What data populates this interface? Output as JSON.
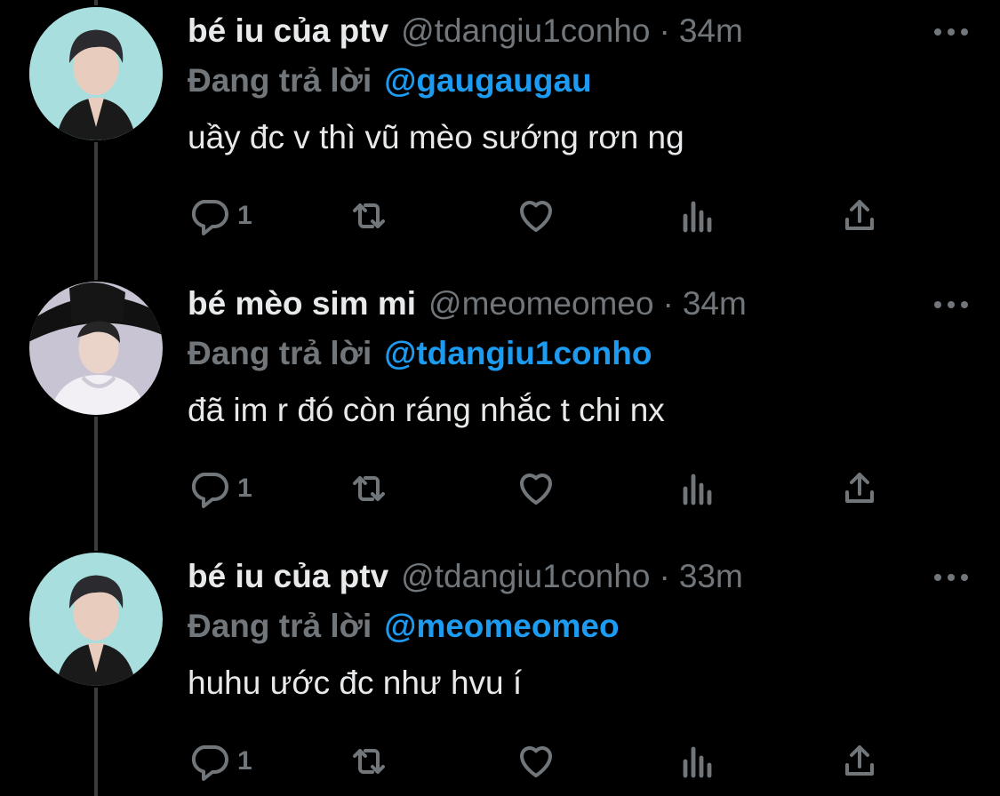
{
  "reply_prefix": "Đang trả lời",
  "tweets": [
    {
      "display_name": "bé iu của ptv",
      "handle": "@tdangiu1conho",
      "separator": "·",
      "time": "34m",
      "reply_to": "@gaugaugau",
      "text": "uầy đc v thì vũ mèo sướng rơn ng",
      "reply_count": "1"
    },
    {
      "display_name": "bé mèo sim mi",
      "handle": "@meomeomeo",
      "separator": "·",
      "time": "34m",
      "reply_to": "@tdangiu1conho",
      "text": "đã im r đó còn ráng nhắc t chi nx",
      "reply_count": "1"
    },
    {
      "display_name": "bé iu của ptv",
      "handle": "@tdangiu1conho",
      "separator": "·",
      "time": "33m",
      "reply_to": "@meomeomeo",
      "text": "huhu ước đc như hvu í",
      "reply_count": "1"
    }
  ],
  "colors": {
    "background": "#000000",
    "text": "#e7e9ea",
    "muted": "#71767b",
    "link": "#1d9bf0",
    "thread_line": "#3b3b3b"
  },
  "icons": [
    "more-icon",
    "reply-icon",
    "retweet-icon",
    "like-icon",
    "views-icon",
    "share-icon"
  ]
}
